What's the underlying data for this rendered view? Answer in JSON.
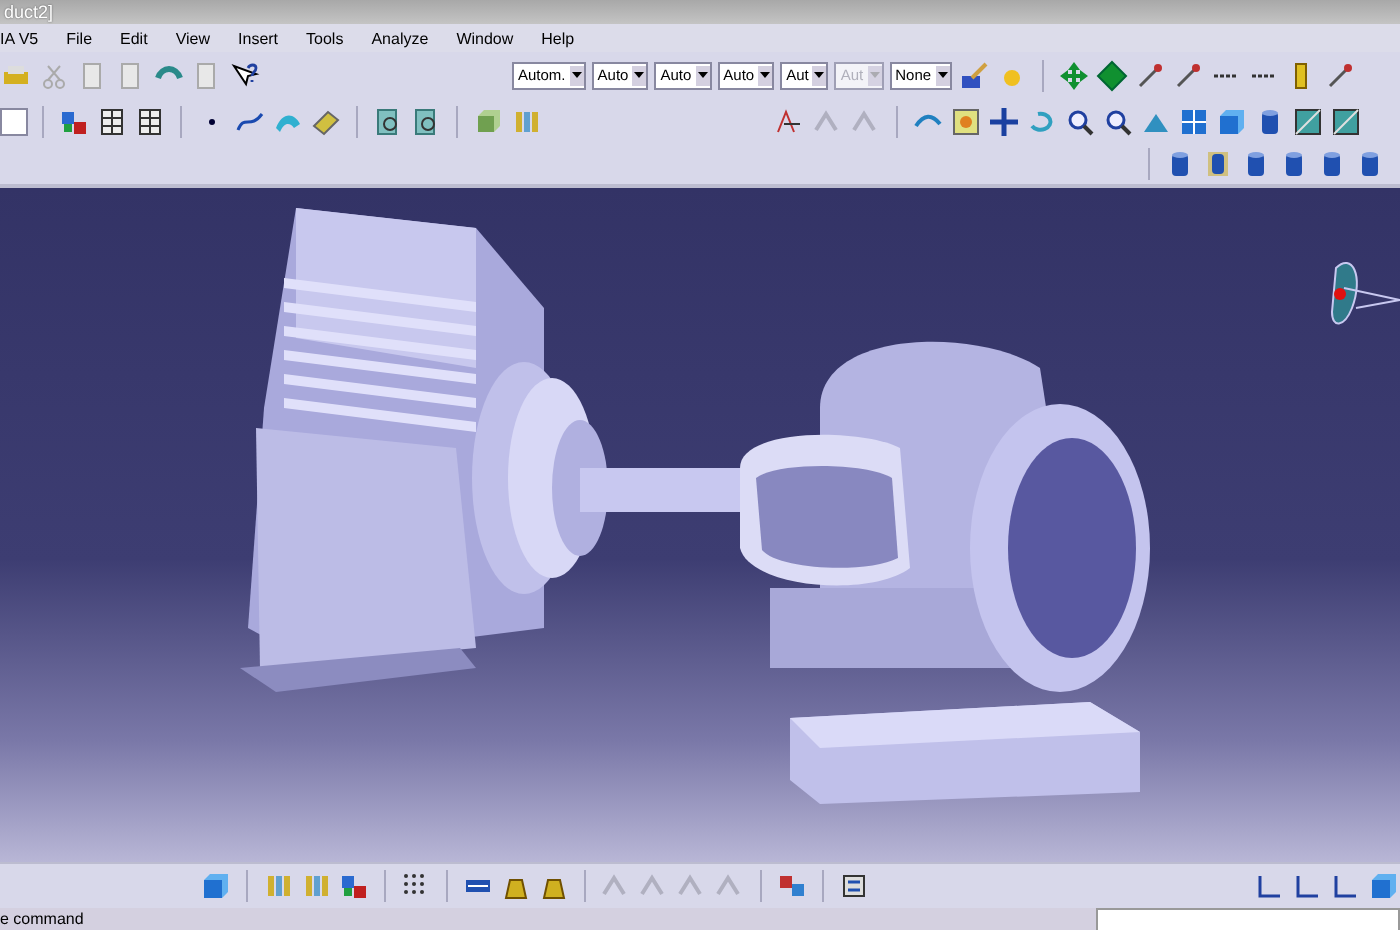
{
  "window": {
    "title": "duct2]"
  },
  "menu": [
    {
      "label": "IA V5"
    },
    {
      "label": "File"
    },
    {
      "label": "Edit"
    },
    {
      "label": "View"
    },
    {
      "label": "Insert"
    },
    {
      "label": "Tools"
    },
    {
      "label": "Analyze"
    },
    {
      "label": "Window"
    },
    {
      "label": "Help"
    }
  ],
  "dropdowns": [
    {
      "value": "Autom.",
      "disabled": false
    },
    {
      "value": "Auto",
      "disabled": false
    },
    {
      "value": "Auto",
      "disabled": false
    },
    {
      "value": "Auto",
      "disabled": false
    },
    {
      "value": "Aut",
      "disabled": false
    },
    {
      "value": "Aut",
      "disabled": true
    },
    {
      "value": "None",
      "disabled": false
    }
  ],
  "status_bar": {
    "text": "e command"
  }
}
